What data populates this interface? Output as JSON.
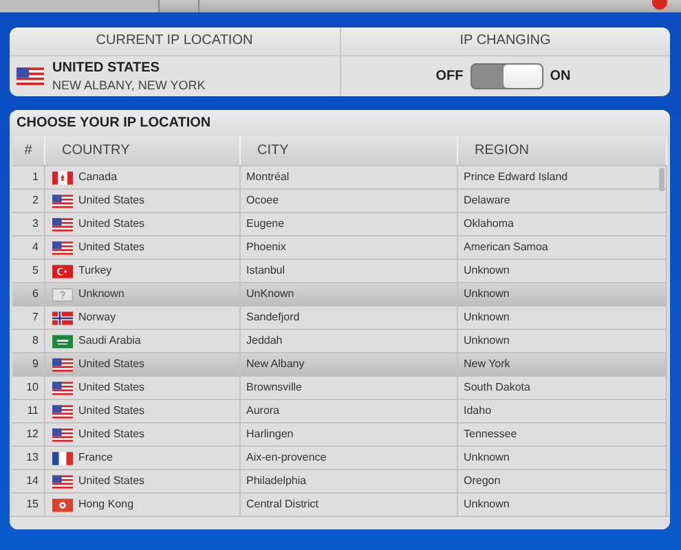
{
  "current_location": {
    "header": "CURRENT IP LOCATION",
    "kind": "us",
    "country": "UNITED STATES",
    "place": "NEW ALBANY, NEW YORK"
  },
  "ip_changing": {
    "header": "IP CHANGING",
    "off_label": "OFF",
    "on_label": "ON",
    "on": true
  },
  "locations": {
    "title": "CHOOSE YOUR IP LOCATION",
    "columns": [
      "#",
      "COUNTRY",
      "CITY",
      "REGION"
    ],
    "rows": [
      {
        "num": "1",
        "kind": "ca",
        "country": "Canada",
        "city": "Montréal",
        "region": "Prince Edward Island",
        "selected": false
      },
      {
        "num": "2",
        "kind": "us",
        "country": "United States",
        "city": "Ocoee",
        "region": "Delaware",
        "selected": false
      },
      {
        "num": "3",
        "kind": "us",
        "country": "United States",
        "city": "Eugene",
        "region": "Oklahoma",
        "selected": false
      },
      {
        "num": "4",
        "kind": "us",
        "country": "United States",
        "city": "Phoenix",
        "region": "American Samoa",
        "selected": false
      },
      {
        "num": "5",
        "kind": "tr",
        "country": "Turkey",
        "city": "Istanbul",
        "region": "Unknown",
        "selected": false
      },
      {
        "num": "6",
        "kind": "unknown",
        "country": "Unknown",
        "city": "UnKnown",
        "region": "Unknown",
        "selected": true
      },
      {
        "num": "7",
        "kind": "no",
        "country": "Norway",
        "city": "Sandefjord",
        "region": "Unknown",
        "selected": false
      },
      {
        "num": "8",
        "kind": "sa",
        "country": "Saudi Arabia",
        "city": "Jeddah",
        "region": "Unknown",
        "selected": false
      },
      {
        "num": "9",
        "kind": "us",
        "country": "United States",
        "city": "New Albany",
        "region": "New York",
        "selected": true
      },
      {
        "num": "10",
        "kind": "us",
        "country": "United States",
        "city": "Brownsville",
        "region": "South Dakota",
        "selected": false
      },
      {
        "num": "11",
        "kind": "us",
        "country": "United States",
        "city": "Aurora",
        "region": "Idaho",
        "selected": false
      },
      {
        "num": "12",
        "kind": "us",
        "country": "United States",
        "city": "Harlingen",
        "region": "Tennessee",
        "selected": false
      },
      {
        "num": "13",
        "kind": "fr",
        "country": "France",
        "city": "Aix-en-provence",
        "region": "Unknown",
        "selected": false
      },
      {
        "num": "14",
        "kind": "us",
        "country": "United States",
        "city": "Philadelphia",
        "region": "Oregon",
        "selected": false
      },
      {
        "num": "15",
        "kind": "hk",
        "country": "Hong Kong",
        "city": "Central District",
        "region": "Unknown",
        "selected": false
      }
    ]
  }
}
